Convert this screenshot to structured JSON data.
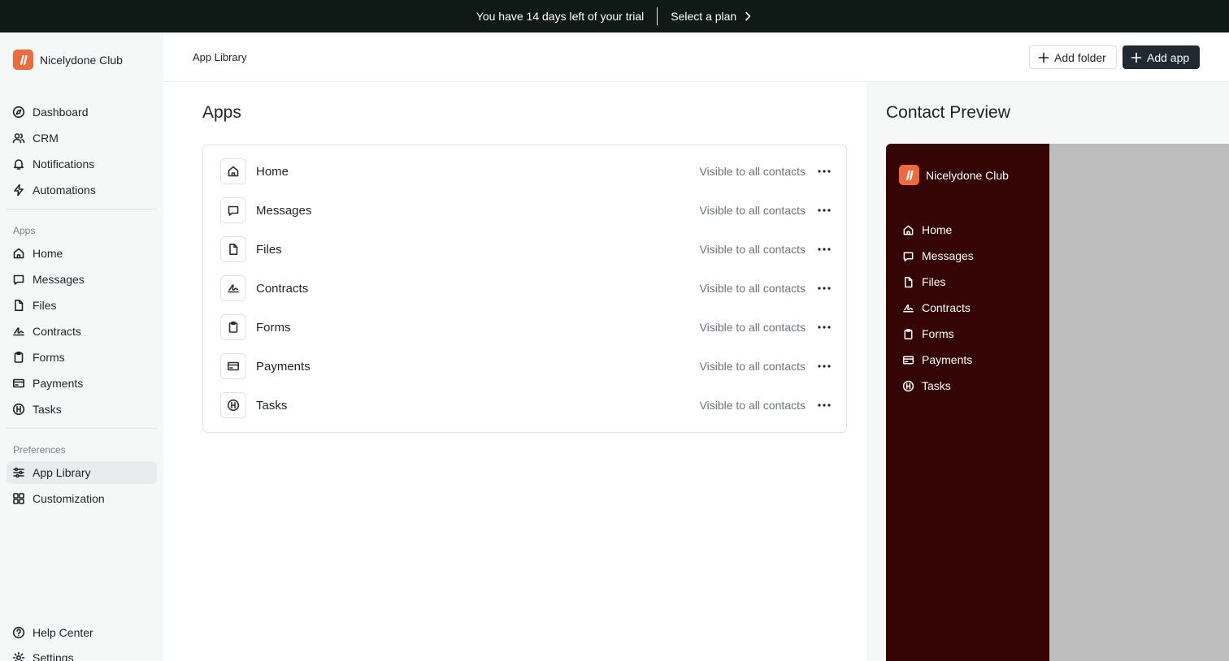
{
  "banner": {
    "message": "You have 14 days left of your trial",
    "cta": "Select a plan"
  },
  "sidebar": {
    "brand": "Nicelydone Club",
    "primary": [
      {
        "label": "Dashboard",
        "icon": "compass-icon"
      },
      {
        "label": "CRM",
        "icon": "users-icon"
      },
      {
        "label": "Notifications",
        "icon": "bell-icon"
      },
      {
        "label": "Automations",
        "icon": "bolt-icon"
      }
    ],
    "apps_label": "Apps",
    "apps": [
      {
        "label": "Home",
        "icon": "home-icon"
      },
      {
        "label": "Messages",
        "icon": "message-icon"
      },
      {
        "label": "Files",
        "icon": "file-icon"
      },
      {
        "label": "Contracts",
        "icon": "signature-icon"
      },
      {
        "label": "Forms",
        "icon": "clipboard-icon"
      },
      {
        "label": "Payments",
        "icon": "credit-card-icon"
      },
      {
        "label": "Tasks",
        "icon": "tasks-icon"
      }
    ],
    "preferences_label": "Preferences",
    "preferences": [
      {
        "label": "App Library",
        "icon": "sliders-icon",
        "active": true
      },
      {
        "label": "Customization",
        "icon": "layout-icon"
      }
    ],
    "bottom": [
      {
        "label": "Help Center",
        "icon": "help-icon"
      },
      {
        "label": "Settings",
        "icon": "gear-icon"
      }
    ]
  },
  "header": {
    "breadcrumb": "App Library",
    "add_folder": "Add folder",
    "add_app": "Add app"
  },
  "main": {
    "title": "Apps",
    "apps": [
      {
        "name": "Home",
        "visibility": "Visible to all contacts",
        "icon": "home-icon"
      },
      {
        "name": "Messages",
        "visibility": "Visible to all contacts",
        "icon": "message-icon"
      },
      {
        "name": "Files",
        "visibility": "Visible to all contacts",
        "icon": "file-icon"
      },
      {
        "name": "Contracts",
        "visibility": "Visible to all contacts",
        "icon": "signature-icon"
      },
      {
        "name": "Forms",
        "visibility": "Visible to all contacts",
        "icon": "clipboard-icon"
      },
      {
        "name": "Payments",
        "visibility": "Visible to all contacts",
        "icon": "credit-card-icon"
      },
      {
        "name": "Tasks",
        "visibility": "Visible to all contacts",
        "icon": "tasks-icon"
      }
    ]
  },
  "preview": {
    "title": "Contact Preview",
    "brand": "Nicelydone Club",
    "items": [
      {
        "label": "Home",
        "icon": "home-icon"
      },
      {
        "label": "Messages",
        "icon": "message-icon"
      },
      {
        "label": "Files",
        "icon": "file-icon"
      },
      {
        "label": "Contracts",
        "icon": "signature-icon"
      },
      {
        "label": "Forms",
        "icon": "clipboard-icon"
      },
      {
        "label": "Payments",
        "icon": "credit-card-icon"
      },
      {
        "label": "Tasks",
        "icon": "tasks-icon"
      }
    ],
    "sidebar_color": "#350505"
  },
  "colors": {
    "brand_accent": "#ee6a3a",
    "banner_bg": "#0f1a17",
    "primary_button": "#212a32",
    "sidebar_bg": "#f6f7f7"
  }
}
